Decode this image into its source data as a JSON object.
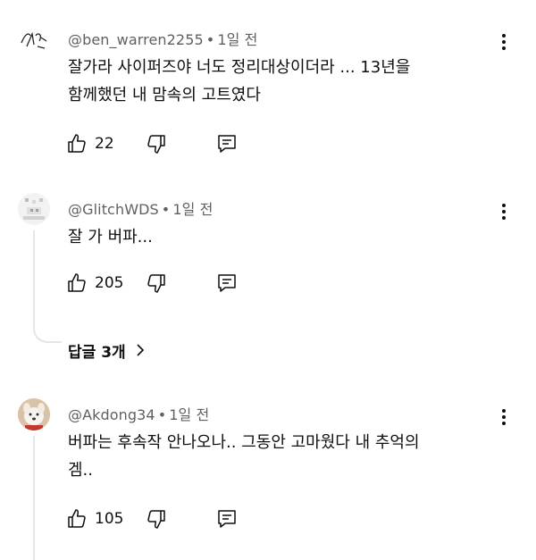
{
  "comments": [
    {
      "author": "@ben_warren2255",
      "time": "1일 전",
      "text_lines": [
        "잘가라 사이퍼즈야 너도 정리대상이더라 ... 13년을",
        "함께했던 내 맘속의 고트였다"
      ],
      "likes": "22",
      "avatar": "sketch-avatar"
    },
    {
      "author": "@GlitchWDS",
      "time": "1일 전",
      "text_lines": [
        "잘 가 버파..."
      ],
      "likes": "205",
      "avatar": "pixel-avatar"
    },
    {
      "author": "@Akdong34",
      "time": "1일 전",
      "text_lines": [
        "버파는 후속작 안나오나.. 그동안 고마웠다 내 추억의",
        "겜.."
      ],
      "likes": "105",
      "avatar": "dog-avatar"
    }
  ],
  "replies_label": "답글 3개",
  "separator": "•",
  "icons": {
    "like": "thumbs-up-icon",
    "dislike": "thumbs-down-icon",
    "reply": "reply-comment-icon",
    "more": "more-vertical-icon",
    "expand": "chevron-right-icon"
  },
  "colors": {
    "meta": "#606060",
    "text": "#0f0f0f",
    "thread": "#e5e5e5"
  }
}
